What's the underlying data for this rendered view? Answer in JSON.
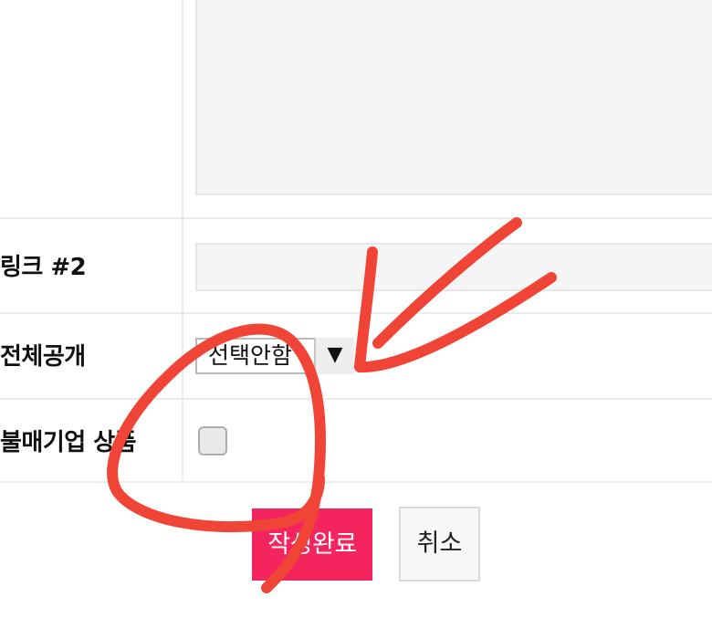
{
  "form": {
    "rows": [
      {
        "label": "링크 #2",
        "field": "link-input",
        "value": ""
      },
      {
        "label": "전체공개",
        "field": "visibility-select",
        "value": "선택안함"
      },
      {
        "label": "불매기업 상품",
        "field": "boycott-checkbox",
        "checked": false
      }
    ],
    "visibility_select": {
      "selected": "선택안함",
      "arrow": "▼"
    }
  },
  "actions": {
    "submit_label": "작성완료",
    "cancel_label": "취소"
  },
  "colors": {
    "submit_bg": "#f4245f",
    "annotation_stroke": "#f04536"
  },
  "icons": {
    "select_arrow": "triangle-down-icon"
  }
}
